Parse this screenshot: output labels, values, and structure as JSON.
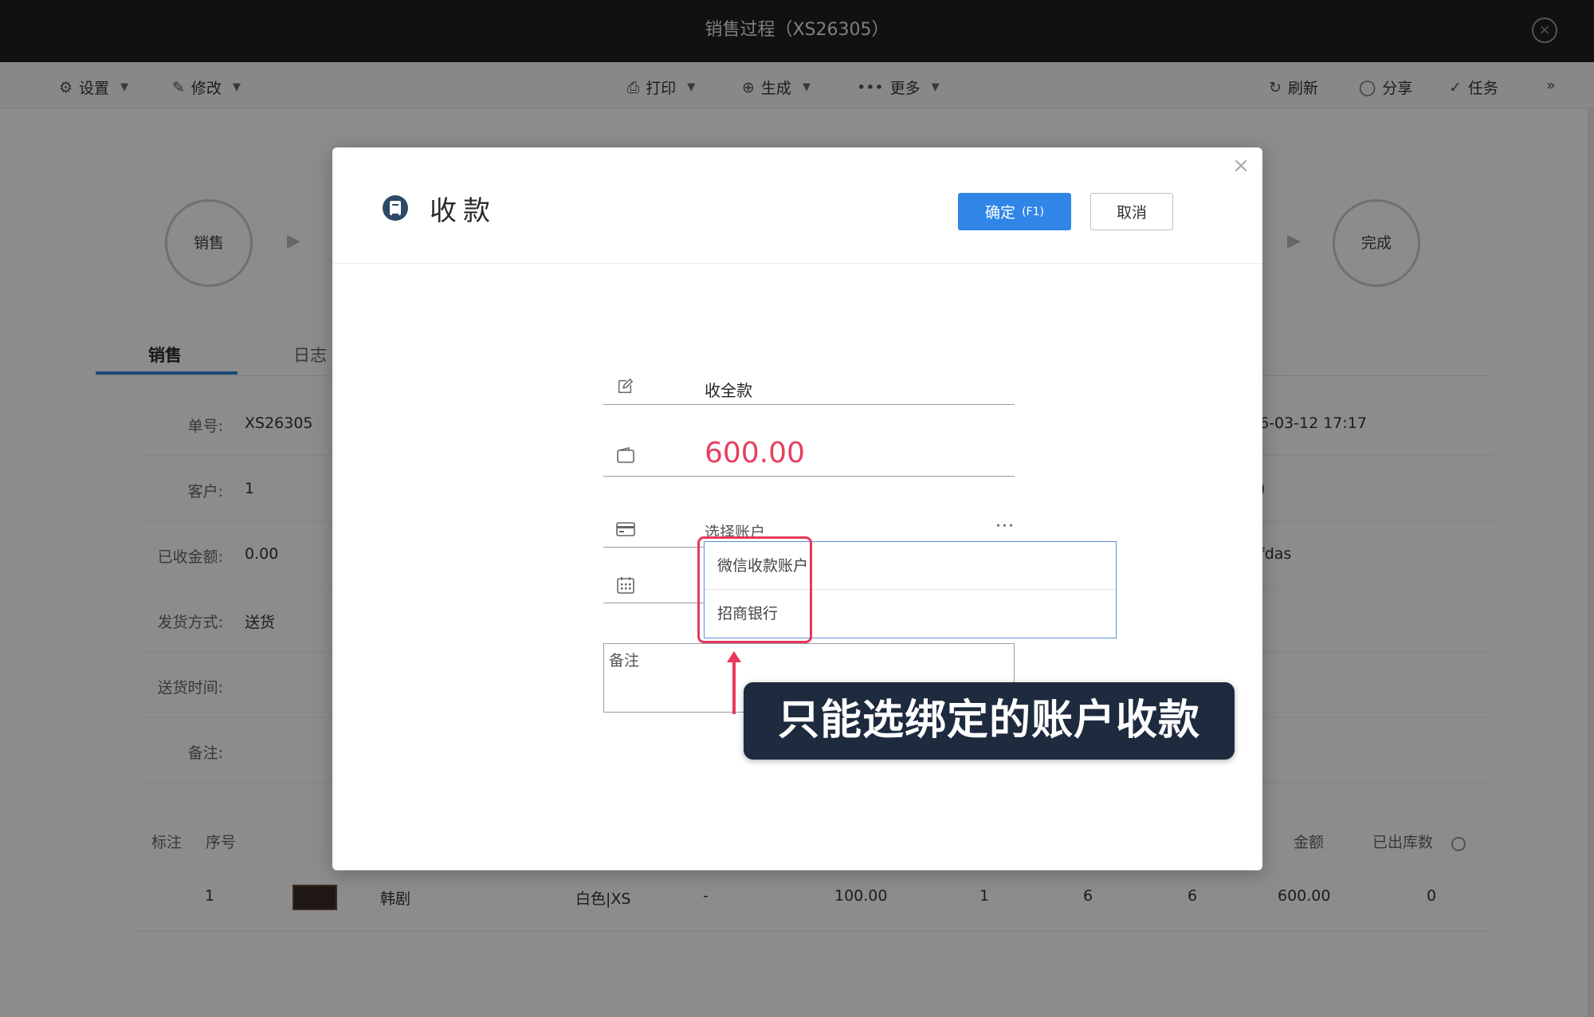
{
  "window": {
    "title": "销售过程（XS26305）"
  },
  "toolbar": {
    "settings": "设置",
    "edit": "修改",
    "print": "打印",
    "generate": "生成",
    "more": "更多",
    "refresh": "刷新",
    "share": "分享",
    "task": "任务",
    "collapse": "»"
  },
  "steps": {
    "first": "销售",
    "last": "完成"
  },
  "tabs": {
    "sales": "销售",
    "log": "日志"
  },
  "details": {
    "order_no_label": "单号:",
    "order_no": "XS26305",
    "customer_label": "客户:",
    "customer": "1",
    "received_label": "已收金额:",
    "received": "0.00",
    "ship_method_label": "发货方式:",
    "ship_method": "送货",
    "delivery_time_label": "送货时间:",
    "remark_label": "备注:",
    "side_datetime": "6-03-12 17:17",
    "side_mid": ")",
    "side_text": "fdas"
  },
  "table": {
    "headers": {
      "mark": "标注",
      "seq": "序号",
      "amount": "金额",
      "shipped": "已出库数"
    },
    "row": {
      "seq": "1",
      "name": "韩剧",
      "spec": "白色|XS",
      "dash": "-",
      "price": "100.00",
      "c1": "1",
      "c2": "6",
      "c3": "6",
      "amount": "600.00",
      "shipped": "0"
    }
  },
  "modal": {
    "title": "收款",
    "ok_label": "确定",
    "ok_hotkey": "(F1)",
    "cancel_label": "取消",
    "close": "×",
    "payment_type": "收全款",
    "amount": "600.00",
    "account_placeholder": "选择账户",
    "account_more": "···",
    "remark_placeholder": "备注",
    "account_options": [
      "微信收款账户",
      "招商银行"
    ]
  },
  "annotation": {
    "callout": "只能选绑定的账户收款"
  },
  "colors": {
    "primary": "#2f86e6",
    "amount_red": "#e5415e",
    "highlight": "#e8385c",
    "callout_bg": "#1e2a3e"
  }
}
